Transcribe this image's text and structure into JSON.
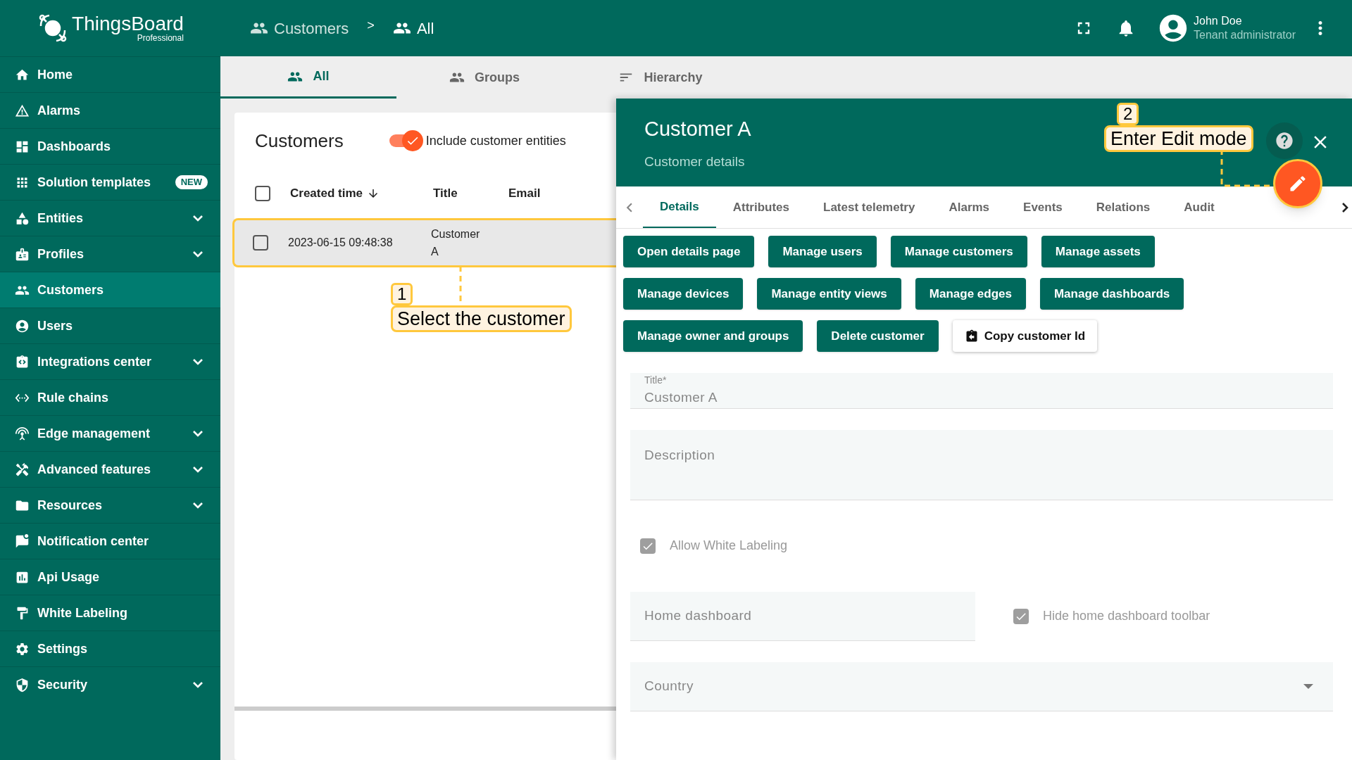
{
  "logo": {
    "name": "ThingsBoard",
    "edition": "Professional"
  },
  "sidebar": {
    "items": [
      {
        "label": "Home",
        "expandable": false,
        "selected": false
      },
      {
        "label": "Alarms",
        "expandable": false,
        "selected": false
      },
      {
        "label": "Dashboards",
        "expandable": false,
        "selected": false
      },
      {
        "label": "Solution templates",
        "expandable": false,
        "selected": false,
        "badge": "NEW"
      },
      {
        "label": "Entities",
        "expandable": true,
        "selected": false
      },
      {
        "label": "Profiles",
        "expandable": true,
        "selected": false
      },
      {
        "label": "Customers",
        "expandable": false,
        "selected": true
      },
      {
        "label": "Users",
        "expandable": false,
        "selected": false
      },
      {
        "label": "Integrations center",
        "expandable": true,
        "selected": false
      },
      {
        "label": "Rule chains",
        "expandable": false,
        "selected": false
      },
      {
        "label": "Edge management",
        "expandable": true,
        "selected": false
      },
      {
        "label": "Advanced features",
        "expandable": true,
        "selected": false
      },
      {
        "label": "Resources",
        "expandable": true,
        "selected": false
      },
      {
        "label": "Notification center",
        "expandable": false,
        "selected": false
      },
      {
        "label": "Api Usage",
        "expandable": false,
        "selected": false
      },
      {
        "label": "White Labeling",
        "expandable": false,
        "selected": false
      },
      {
        "label": "Settings",
        "expandable": false,
        "selected": false
      },
      {
        "label": "Security",
        "expandable": true,
        "selected": false
      }
    ]
  },
  "topbar": {
    "breadcrumbs": [
      "Customers",
      "All"
    ],
    "separator": ">",
    "user": {
      "name": "John Doe",
      "role": "Tenant administrator"
    }
  },
  "group_tabs": [
    {
      "label": "All",
      "selected": true
    },
    {
      "label": "Groups",
      "selected": false
    },
    {
      "label": "Hierarchy",
      "selected": false
    }
  ],
  "customers_card": {
    "title": "Customers",
    "include_toggle": {
      "label": "Include customer entities",
      "on": true
    },
    "header_checkbox": {
      "checked": false
    },
    "columns": [
      {
        "label": "Created time",
        "sorted": true
      },
      {
        "label": "Title",
        "sorted": false
      },
      {
        "label": "Email",
        "sorted": false
      }
    ],
    "rows": [
      {
        "created_time": "2023-06-15 09:48:38",
        "title": "Customer A",
        "checked": false,
        "selected": true
      }
    ]
  },
  "details": {
    "title": "Customer A",
    "subtitle": "Customer details",
    "tabs": [
      {
        "label": "Details",
        "selected": true
      },
      {
        "label": "Attributes",
        "selected": false
      },
      {
        "label": "Latest telemetry",
        "selected": false
      },
      {
        "label": "Alarms",
        "selected": false
      },
      {
        "label": "Events",
        "selected": false
      },
      {
        "label": "Relations",
        "selected": false
      },
      {
        "label": "Audit",
        "selected": false
      }
    ],
    "actions": [
      "Open details page",
      "Manage users",
      "Manage customers",
      "Manage assets",
      "Manage devices",
      "Manage entity views",
      "Manage edges",
      "Manage dashboards",
      "Manage owner and groups",
      "Delete customer"
    ],
    "copy_button": "Copy customer Id",
    "fields": [
      {
        "kind": "text",
        "label": "Title*",
        "value": "Customer A"
      },
      {
        "kind": "textarea",
        "placeholder": "Description"
      },
      {
        "kind": "checkbox",
        "label": "Allow White Labeling",
        "checked": true,
        "disabled": true
      },
      {
        "kind": "row",
        "items": [
          {
            "kind": "text",
            "placeholder": "Home dashboard"
          },
          {
            "kind": "checkbox",
            "label": "Hide home dashboard toolbar",
            "checked": true,
            "disabled": true
          }
        ]
      },
      {
        "kind": "select",
        "placeholder": "Country"
      }
    ]
  },
  "annotations": [
    {
      "number": "1",
      "text": "Select the customer"
    },
    {
      "number": "2",
      "text": "Enter Edit mode"
    }
  ]
}
